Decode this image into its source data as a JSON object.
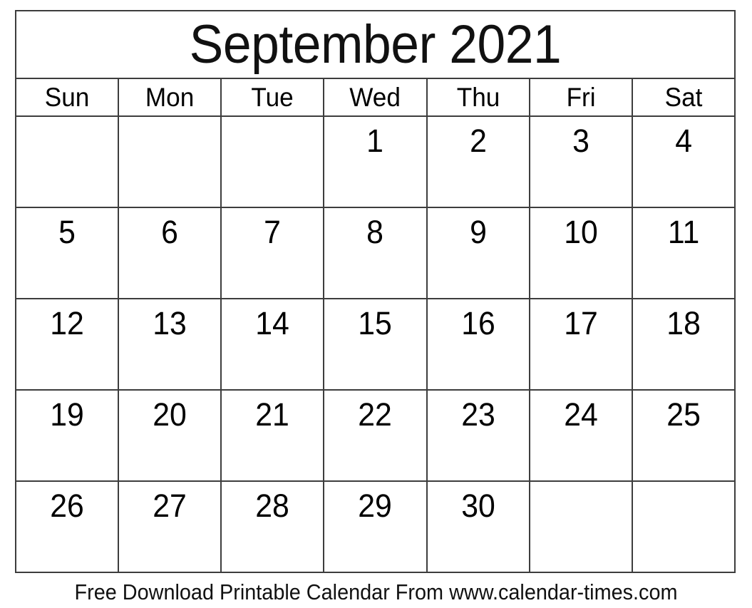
{
  "calendar": {
    "title": "September 2021",
    "month_name": "September",
    "year": "2021",
    "weekdays": [
      {
        "short": "Sun"
      },
      {
        "short": "Mon"
      },
      {
        "short": "Tue"
      },
      {
        "short": "Wed"
      },
      {
        "short": "Thu"
      },
      {
        "short": "Fri"
      },
      {
        "short": "Sat"
      }
    ],
    "weeks": [
      {
        "days": [
          "",
          "",
          "",
          "1",
          "2",
          "3",
          "4"
        ]
      },
      {
        "days": [
          "5",
          "6",
          "7",
          "8",
          "9",
          "10",
          "11"
        ]
      },
      {
        "days": [
          "12",
          "13",
          "14",
          "15",
          "16",
          "17",
          "18"
        ]
      },
      {
        "days": [
          "19",
          "20",
          "21",
          "22",
          "23",
          "24",
          "25"
        ]
      },
      {
        "days": [
          "26",
          "27",
          "28",
          "29",
          "30",
          "",
          ""
        ]
      }
    ],
    "border_color": "#3d3d3d",
    "text_color": "#000000",
    "background_color": "#ffffff"
  },
  "footer": {
    "text": "Free Download Printable Calendar From www.calendar-times.com"
  }
}
